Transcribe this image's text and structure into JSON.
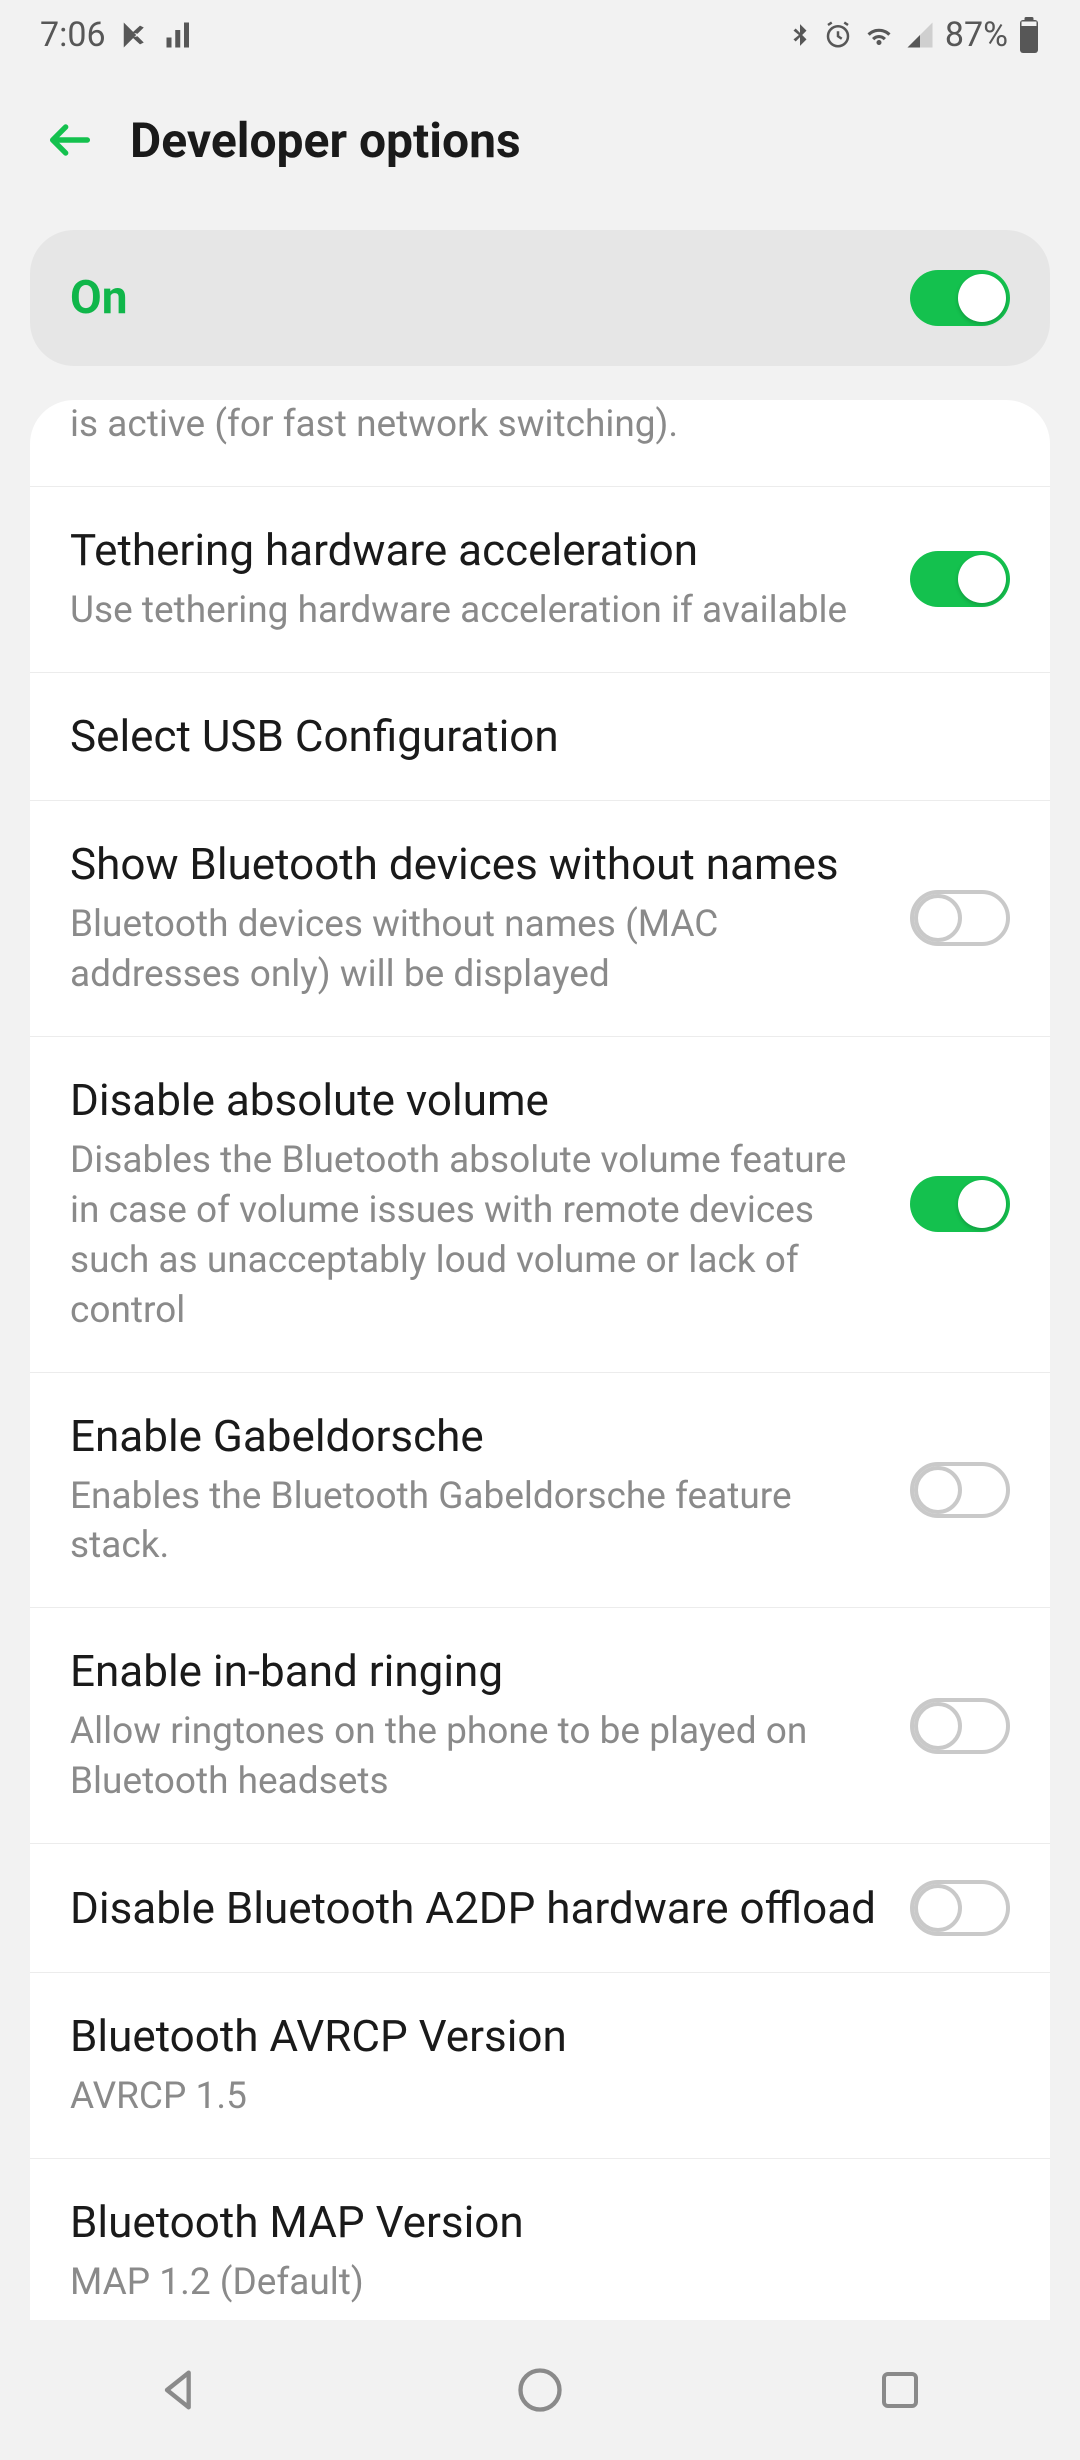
{
  "statusbar": {
    "time": "7:06",
    "battery_text": "87%"
  },
  "appbar": {
    "title": "Developer options"
  },
  "master": {
    "label": "On",
    "on": true
  },
  "partial_row_subtitle": "is active (for fast network switching).",
  "rows": [
    {
      "key": "tethering-hw-accel",
      "title": "Tethering hardware acceleration",
      "sub": "Use tethering hardware acceleration if available",
      "toggle": true,
      "on": true
    },
    {
      "key": "select-usb-config",
      "title": "Select USB Configuration",
      "sub": "",
      "toggle": false
    },
    {
      "key": "show-bt-no-names",
      "title": "Show Bluetooth devices without names",
      "sub": "Bluetooth devices without names (MAC addresses only) will be displayed",
      "toggle": true,
      "on": false
    },
    {
      "key": "disable-absolute-volume",
      "title": "Disable absolute volume",
      "sub": "Disables the Bluetooth absolute volume feature in case of volume issues with remote devices such as unacceptably loud volume or lack of control",
      "toggle": true,
      "on": true
    },
    {
      "key": "enable-gabeldorsche",
      "title": "Enable Gabeldorsche",
      "sub": "Enables the Bluetooth Gabeldorsche feature stack.",
      "toggle": true,
      "on": false
    },
    {
      "key": "enable-inband-ringing",
      "title": "Enable in-band ringing",
      "sub": "Allow ringtones on the phone to be played on Bluetooth headsets",
      "toggle": true,
      "on": false
    },
    {
      "key": "disable-a2dp-hw-offload",
      "title": "Disable Bluetooth A2DP hardware offload",
      "sub": "",
      "toggle": true,
      "on": false
    },
    {
      "key": "bt-avrcp-version",
      "title": "Bluetooth AVRCP Version",
      "sub": "AVRCP 1.5",
      "toggle": false
    },
    {
      "key": "bt-map-version",
      "title": "Bluetooth MAP Version",
      "sub": "MAP 1.2 (Default)",
      "toggle": false
    }
  ]
}
